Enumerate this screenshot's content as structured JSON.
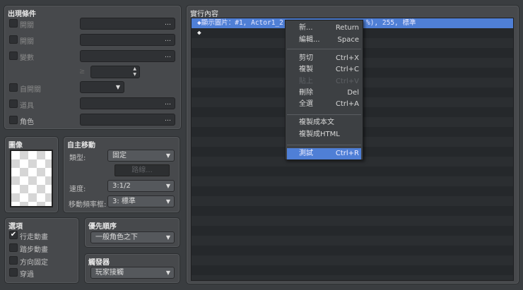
{
  "conditions": {
    "title": "出現條件",
    "rows": [
      {
        "label": "開關",
        "type": "picker"
      },
      {
        "label": "開關",
        "type": "picker"
      },
      {
        "label": "變數",
        "type": "picker"
      },
      {
        "label": "自開關",
        "type": "select"
      },
      {
        "label": "道具",
        "type": "picker"
      },
      {
        "label": "角色",
        "type": "picker"
      }
    ],
    "compare": "≥",
    "ellipsis": "…"
  },
  "image": {
    "title": "圖像"
  },
  "movement": {
    "title": "自主移動",
    "type_label": "類型:",
    "type_value": "固定",
    "route_button": "路線...",
    "speed_label": "速度:",
    "speed_value": "3:1/2",
    "freq_label": "移動頻率框:",
    "freq_value": "3: 標準"
  },
  "options": {
    "title": "選項",
    "items": [
      {
        "label": "行走動畫",
        "checked": true
      },
      {
        "label": "踏步動畫",
        "checked": false
      },
      {
        "label": "方向固定",
        "checked": false
      },
      {
        "label": "穿過",
        "checked": false
      }
    ]
  },
  "priority": {
    "title": "優先順序",
    "value": "一般角色之下"
  },
  "trigger": {
    "title": "觸發器",
    "value": "玩家接觸"
  },
  "contents": {
    "title": "實行內容",
    "rows": [
      {
        "left": "◆顯示圖片：#1, Actor1_2,",
        "right": "%), 255, 標準"
      },
      {
        "left": "◆"
      }
    ]
  },
  "context_menu": {
    "items": [
      {
        "label": "新...",
        "shortcut": "Return"
      },
      {
        "label": "編輯...",
        "shortcut": "Space"
      },
      {
        "label": "剪切",
        "shortcut": "Ctrl+X"
      },
      {
        "label": "複製",
        "shortcut": "Ctrl+C"
      },
      {
        "label": "貼上",
        "shortcut": "Ctrl+V",
        "disabled": true
      },
      {
        "label": "刪除",
        "shortcut": "Del"
      },
      {
        "label": "全選",
        "shortcut": "Ctrl+A"
      },
      {
        "label": "複製成本文"
      },
      {
        "label": "複製成HTML"
      },
      {
        "label": "測試",
        "shortcut": "Ctrl+R",
        "highlighted": true
      }
    ]
  },
  "colors": {
    "highlight": "#4f7fd6",
    "background": "#3a3d40"
  }
}
